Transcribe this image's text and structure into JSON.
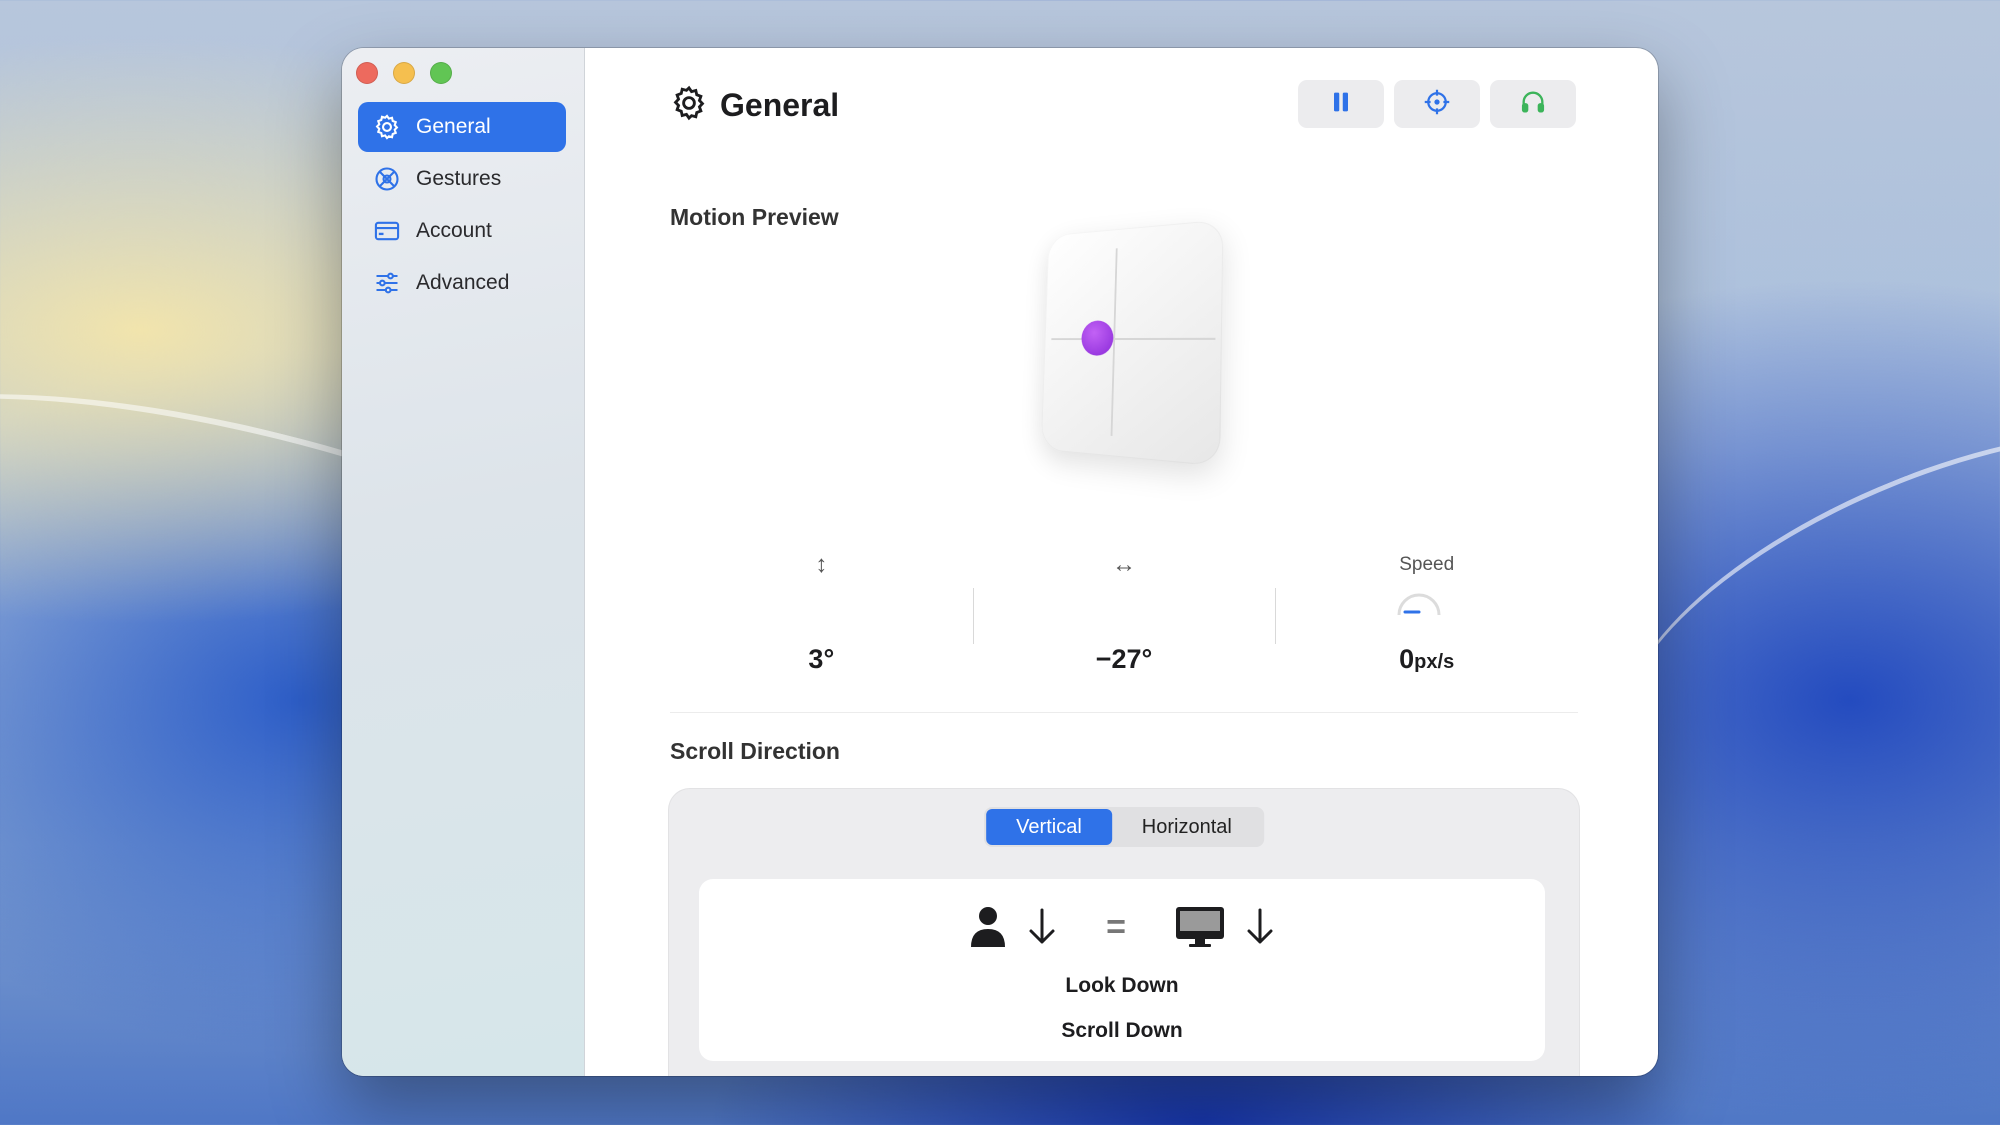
{
  "window": {
    "traffic_lights": [
      "close",
      "minimize",
      "zoom"
    ]
  },
  "sidebar": {
    "items": [
      {
        "label": "General",
        "icon": "gear-icon",
        "selected": true
      },
      {
        "label": "Gestures",
        "icon": "gestures-icon",
        "selected": false
      },
      {
        "label": "Account",
        "icon": "card-icon",
        "selected": false
      },
      {
        "label": "Advanced",
        "icon": "sliders-icon",
        "selected": false
      }
    ]
  },
  "header": {
    "title": "General",
    "icon": "gear-icon"
  },
  "toolbar": {
    "buttons": [
      {
        "name": "pause",
        "icon": "pause-icon",
        "color": "#2f72e8"
      },
      {
        "name": "recenter",
        "icon": "crosshair-icon",
        "color": "#2f72e8"
      },
      {
        "name": "headphones",
        "icon": "headphones-icon",
        "color": "#3cb45a"
      }
    ]
  },
  "motion_preview": {
    "title": "Motion Preview",
    "metrics": [
      {
        "icon": "vertical-arrows-icon",
        "value": "3°"
      },
      {
        "icon": "horizontal-arrows-icon",
        "value": "−27°"
      },
      {
        "label": "Speed",
        "value": "0",
        "unit": "px/s",
        "gauge_level": 0
      }
    ]
  },
  "scroll_direction": {
    "title": "Scroll Direction",
    "options": [
      "Vertical",
      "Horizontal"
    ],
    "selected": "Vertical",
    "illustration": {
      "icons": [
        "person-icon",
        "arrow-down-icon",
        "equals-icon",
        "monitor-icon",
        "arrow-down-icon"
      ],
      "equals": "=",
      "line1": "Look Down",
      "line2": "Scroll Down"
    }
  },
  "colors": {
    "accent": "#2f72e8",
    "pointer": "#a13ee6"
  }
}
